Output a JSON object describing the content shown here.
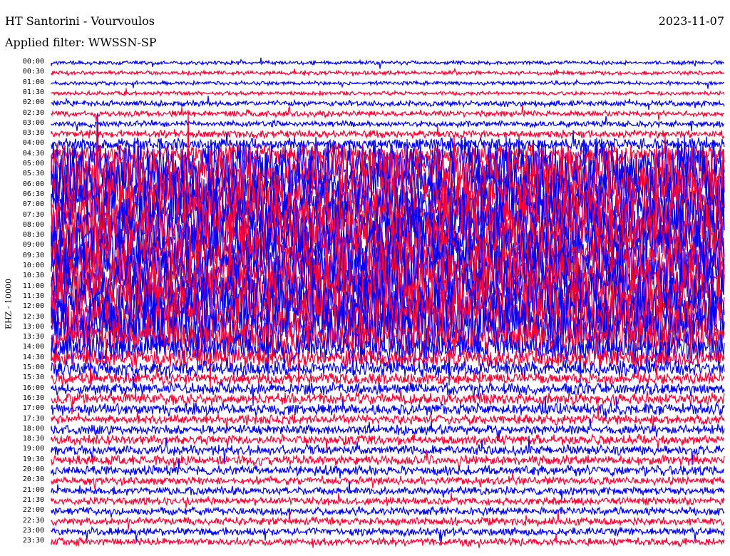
{
  "header": {
    "title": "HT Santorini - Vourvoulos",
    "filter": "Applied filter: WWSSN-SP",
    "date": "2023-11-07",
    "channel_label": "EHZ - 10000"
  },
  "colors": {
    "even_trace": "#0000ff",
    "odd_trace": "#ff0033"
  },
  "chart_data": {
    "type": "line",
    "title": "HT Santorini - Vourvoulos",
    "ylabel": "EHZ - 10000",
    "row_labels": [
      "00:00",
      "00:30",
      "01:00",
      "01:30",
      "02:00",
      "02:30",
      "03:00",
      "03:30",
      "04:00",
      "04:30",
      "05:00",
      "05:30",
      "06:00",
      "06:30",
      "07:00",
      "07:30",
      "08:00",
      "08:30",
      "09:00",
      "09:30",
      "10:00",
      "10:30",
      "11:00",
      "11:30",
      "12:00",
      "12:30",
      "13:00",
      "13:30",
      "14:00",
      "14:30",
      "15:00",
      "15:30",
      "16:00",
      "16:30",
      "17:00",
      "17:30",
      "18:00",
      "18:30",
      "19:00",
      "19:30",
      "20:00",
      "20:30",
      "21:00",
      "21:30",
      "22:00",
      "22:30",
      "23:00",
      "23:30"
    ],
    "relative_activity": [
      1,
      1,
      1,
      1,
      1.5,
      1.5,
      1.5,
      2,
      3,
      5,
      10,
      10,
      10,
      10,
      10,
      10,
      10,
      10,
      10,
      10,
      10,
      10,
      10,
      10,
      10,
      10,
      10,
      9,
      8,
      5,
      4,
      3,
      3,
      3,
      3,
      2.5,
      2.5,
      2.5,
      2.5,
      2.5,
      2.5,
      2,
      2,
      2,
      2,
      2,
      2,
      2
    ]
  }
}
